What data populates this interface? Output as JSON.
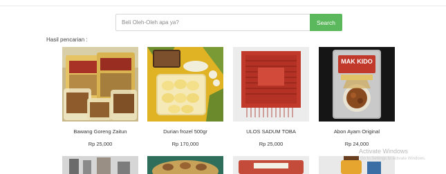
{
  "search": {
    "placeholder": "Beli Oleh-Oleh apa ya?",
    "button_label": "Search"
  },
  "results_label": "Hasil pencarian :",
  "products": [
    {
      "name": "Bawang Goreng Zaitun",
      "price": "Rp 25,000"
    },
    {
      "name": "Durian frozel 500gr",
      "price": "Rp 170,000"
    },
    {
      "name": "ULOS SADUM TOBA",
      "price": "Rp 25,000"
    },
    {
      "name": "Abon Ayam Original",
      "price": "Rp 24,000"
    }
  ],
  "product_images": [
    {
      "label_top": "",
      "label_bottom": ""
    },
    {
      "label_top": "",
      "label_bottom": ""
    },
    {
      "label_top": "",
      "label_bottom": ""
    },
    {
      "label_top": "MAK KIDO",
      "label_bottom": ""
    }
  ],
  "watermark": {
    "title": "Activate Windows",
    "subtitle": "Go to Settings to activate Windows."
  },
  "colors": {
    "accent": "#5cb85c"
  }
}
